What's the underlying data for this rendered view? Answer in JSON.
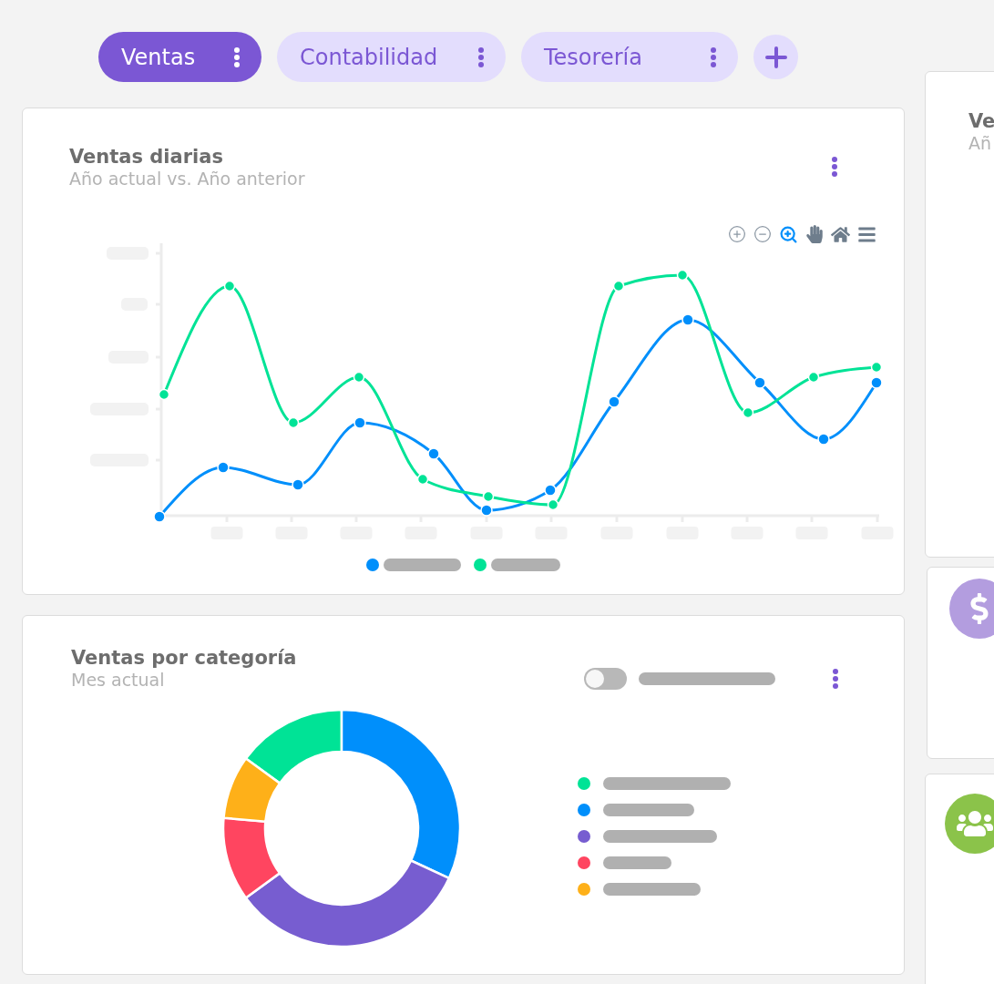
{
  "tabs": [
    {
      "label": "Ventas",
      "selected": true
    },
    {
      "label": "Contabilidad",
      "selected": false
    },
    {
      "label": "Tesorería",
      "selected": false
    }
  ],
  "daily_sales": {
    "title": "Ventas diarias",
    "subtitle": "Año actual vs. Año anterior",
    "legend": [
      {
        "color": "#008ffb"
      },
      {
        "color": "#00e396"
      }
    ]
  },
  "category_sales": {
    "title": "Ventas por categoría",
    "subtitle": "Mes actual",
    "toggle": {
      "on": false
    },
    "legend": [
      {
        "color": "#00e396"
      },
      {
        "color": "#008ffb"
      },
      {
        "color": "#775dd0"
      },
      {
        "color": "#ff4560"
      },
      {
        "color": "#feb019"
      }
    ]
  },
  "side_cards": [
    {
      "kind": "chart",
      "title": "Ve",
      "subtitle": "Añ"
    },
    {
      "kind": "money"
    },
    {
      "kind": "people"
    }
  ]
}
